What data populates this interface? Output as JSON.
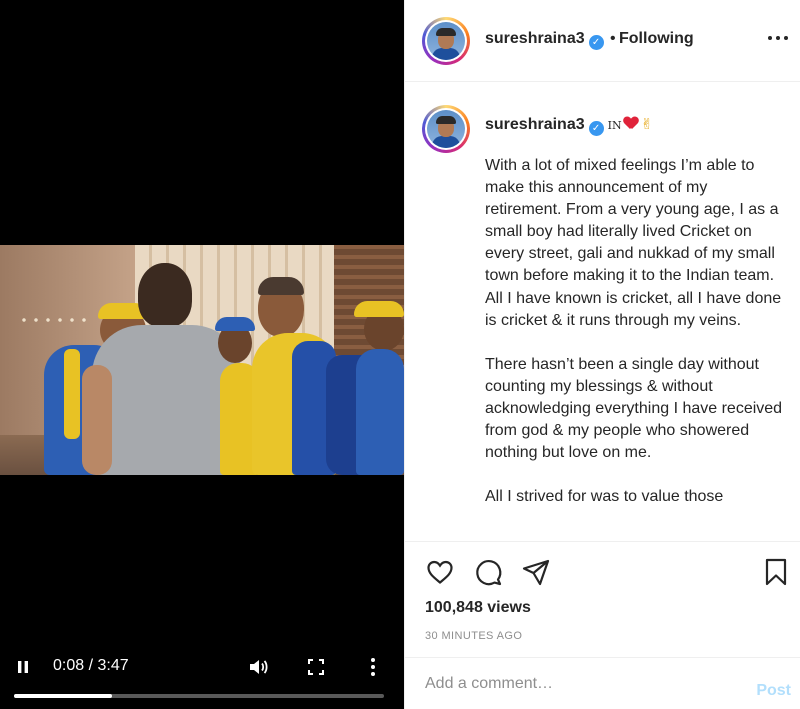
{
  "video": {
    "current_time": "0:08",
    "duration": "3:47",
    "time_display": "0:08 / 3:47",
    "progress_fraction": 0.265,
    "buffered_fraction": 0.265
  },
  "header": {
    "username": "sureshraina3",
    "verified": true,
    "separator": "•",
    "follow_status": "Following"
  },
  "caption": {
    "username": "sureshraina3",
    "flag_text": "IN",
    "paragraphs": [
      "With a lot of mixed feelings I’m able to make this announcement of my retirement. From a very young age, I as a small boy had literally lived Cricket on every street, gali and nukkad of my small town before making it to the Indian team.",
      "All I have known is cricket, all I have done is cricket & it runs through my veins.",
      "",
      "There hasn’t been a single day without counting my blessings & without acknowledging everything I have received from god & my people who showered nothing but love on me.",
      "",
      "All I strived for was to value those"
    ]
  },
  "actions": {
    "views": "100,848 views",
    "time_ago": "30 MINUTES AGO"
  },
  "comment": {
    "placeholder": "Add a comment…",
    "post_label": "Post"
  },
  "colors": {
    "verified_blue": "#3897f0",
    "post_button_disabled": "#b2dffc",
    "meta_gray": "#8e8e8e",
    "heart_red": "#e0233a"
  },
  "icons": {
    "video": [
      "pause-icon",
      "volume-icon",
      "fullscreen-icon",
      "video-more-icon"
    ],
    "actions": [
      "heart-icon",
      "comment-icon",
      "share-icon",
      "bookmark-icon"
    ],
    "header": [
      "more-options-icon",
      "verified-badge-icon"
    ]
  }
}
